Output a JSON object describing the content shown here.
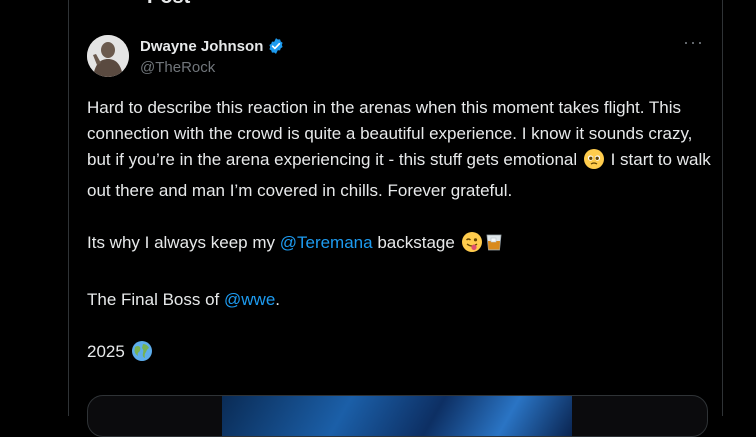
{
  "header": {
    "title": "Post",
    "back_icon": "arrow-left-icon"
  },
  "author": {
    "name": "Dwayne Johnson",
    "handle": "@TheRock",
    "verified": true,
    "verified_color": "#1d9bf0"
  },
  "post": {
    "para1_text": "Hard to describe this reaction in the arenas when this moment takes flight. This connection with the crowd is quite a beautiful experience. I know it sounds crazy, but if you’re in the arena experiencing it - this stuff gets emotional",
    "para1_tail": " I start to walk out there and man I’m covered in chills. Forever grateful.",
    "para2_pre": "Its why I always keep my ",
    "para2_mention": "@Teremana",
    "para2_post": " backstage ",
    "para3_pre": "The Final Boss of ",
    "para3_mention": "@wwe",
    "para3_post": ".",
    "para4_text": "2025 "
  },
  "more_label": "···",
  "colors": {
    "background": "#000000",
    "text": "#e7e9ea",
    "muted": "#71767b",
    "link": "#1d9bf0",
    "border": "#2f3336"
  }
}
